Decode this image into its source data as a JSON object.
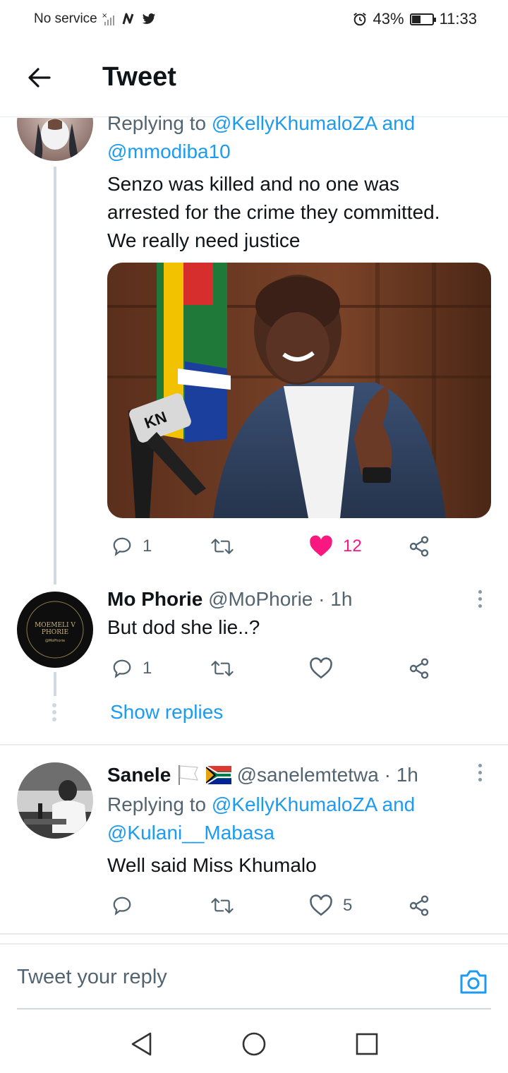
{
  "status_bar": {
    "carrier": "No service",
    "battery_percent_label": "43%",
    "battery_fraction": 0.43,
    "time": "11:33"
  },
  "header": {
    "title": "Tweet"
  },
  "tweet_main": {
    "replying_prefix": "Replying to",
    "replying_handle_1": "@KellyKhumaloZA",
    "replying_and": "and",
    "replying_handle_2": "@mmodiba10",
    "body_line_1": "Senzo was killed and no one was",
    "body_line_2": "arrested for the crime they committed.",
    "body_line_3": "We really need justice",
    "reply_count": "1",
    "like_count": "12"
  },
  "tweet_mo": {
    "name": "Mo Phorie",
    "handle": "@MoPhorie",
    "time": "· 1h",
    "body": "But dod she lie..?",
    "reply_count": "1",
    "avatar_text_1": "MOEMELI V",
    "avatar_text_2": "PHORIE",
    "avatar_text_3": "@MoPhorie"
  },
  "show_replies": "Show replies",
  "tweet_sanele": {
    "name": "Sanele",
    "handle": "@sanelemtetwa",
    "time": "· 1h",
    "replying_prefix": "Replying to",
    "replying_handle_1": "@KellyKhumaloZA",
    "replying_and": "and",
    "replying_handle_2": "@Kulani__Mabasa",
    "body": "Well said Miss Khumalo",
    "like_count": "5"
  },
  "reply_box": {
    "placeholder": "Tweet your reply"
  },
  "colors": {
    "accent": "#1d9bf0",
    "like": "#f91880",
    "muted": "#536471"
  }
}
